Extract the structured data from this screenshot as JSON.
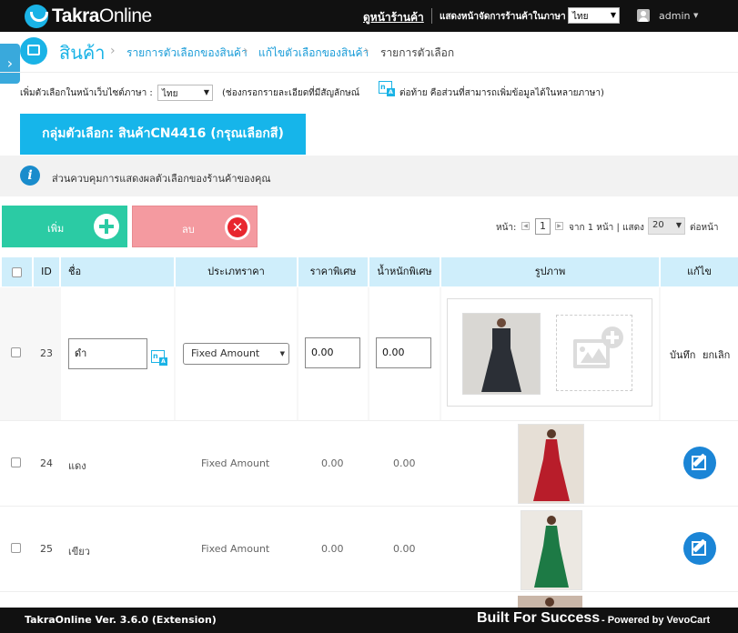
{
  "header": {
    "logo_bold": "Takra",
    "logo_light": "Online",
    "view_store": "ดูหน้าร้านค้า",
    "store_lang_label": "แสดงหน้าจัดการร้านค้าในภาษา",
    "store_lang_value": "ไทย",
    "user": "admin"
  },
  "breadcrumb": {
    "title": "สินค้า",
    "link1": "รายการตัวเลือกของสินค้า",
    "link2": "แก้ไขตัวเลือกของสินค้า",
    "current": "รายการตัวเลือก"
  },
  "lang_line": {
    "label": "เพิ่มตัวเลือกในหน้าเว็บไซต์ภาษา :",
    "value": "ไทย",
    "note_a": "(ช่องกรอกรายละเอียดที่มีสัญลักษณ์",
    "note_b": "ต่อท้าย คือส่วนที่สามารถเพิ่มข้อมูลได้ในหลายภาษา)"
  },
  "group_banner": "กลุ่มตัวเลือก: สินค้าCN4416 (กรุณเลือกสี)",
  "info_text": "ส่วนควบคุมการแสดงผลตัวเลือกของร้านค้าของคุณ",
  "actions": {
    "add": "เพิ่ม",
    "delete": "ลบ"
  },
  "pagination": {
    "page_label": "หน้า:",
    "page_value": "1",
    "of_text": "จาก 1 หน้า | แสดง",
    "per_page": "20",
    "per_page_suffix": "ต่อหน้า"
  },
  "table": {
    "headers": {
      "id": "ID",
      "name": "ชื่อ",
      "price_type": "ประเภทราคา",
      "special_price": "ราคาพิเศษ",
      "special_weight": "น้ำหนักพิเศษ",
      "image": "รูปภาพ",
      "edit": "แก้ไข"
    },
    "rows": [
      {
        "id": "23",
        "name": "ดำ",
        "price_type": "Fixed Amount",
        "special_price": "0.00",
        "special_weight": "0.00",
        "save": "บันทึก",
        "cancel": "ยกเลิก",
        "dress_color": "#2b2f36"
      },
      {
        "id": "24",
        "name": "แดง",
        "price_type": "Fixed Amount",
        "special_price": "0.00",
        "special_weight": "0.00",
        "dress_color": "#b81d2a"
      },
      {
        "id": "25",
        "name": "เขียว",
        "price_type": "Fixed Amount",
        "special_price": "0.00",
        "special_weight": "0.00",
        "dress_color": "#1d7a45"
      }
    ]
  },
  "footer": {
    "version": "TakraOnline Ver. 3.6.0 (Extension)",
    "built": "Built For Success",
    "powered": "- Powered by VevoCart"
  }
}
